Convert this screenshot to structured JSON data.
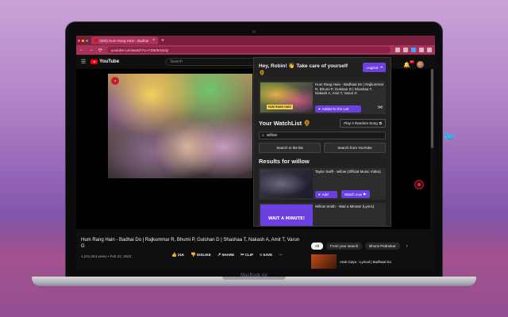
{
  "device": {
    "label": "MacBook Air"
  },
  "browser": {
    "tab_title": "(580) Hum Rang Hain - Badhai",
    "tab_close": "×",
    "new_tab": "+",
    "url": "youtube.com/watch?v=I7Z6Z5XaoQ"
  },
  "youtube": {
    "logo_text": "YouTube",
    "search_placeholder": "Search",
    "notification_count": "9+",
    "video_title": "Hum Rang Hain - Badhai Do | Rajkummar R, Bhumi P, Gulshan D | Shashaa T, Nakash A, Amit T, Varun G",
    "video_meta": "1,241,064 views • Feb 23, 2022",
    "actions": {
      "like": "21K",
      "dislike": "DISLIKE",
      "share": "SHARE",
      "clip": "CLIP",
      "save": "SAVE"
    },
    "chips": [
      "All",
      "From your search",
      "Bhumi Pednekar"
    ],
    "recommended_title": "Atak Gaya - Lyrical | Badhaai Do"
  },
  "extension": {
    "greeting": "Hey, Robin! 👋 Take care of yourself 🌻",
    "logout_label": "LogOut",
    "current_song": {
      "title": "Hum Rang Hain - Badhaai Do | Rajkummar R, Bhumi P, Gulshan D | Shashaa T, Nakash A, Amit T, Varun G",
      "thumb_label": "HUM RANG HAIN",
      "added_label": "Added to the List"
    },
    "watchlist_title": "Your WatchList 🌻",
    "random_label": "Play A Random Song",
    "search_value": "willow",
    "search_in_list": "Search in the list",
    "search_youtube": "Search from YouTube",
    "results_title": "Results for willow",
    "results": [
      {
        "title": "Taylor Swift - willow (Official Music Video)",
        "add_label": "Add",
        "watch_label": "Watch now"
      },
      {
        "title": "Willow Smith - Wait a Minute! (Lyrics)",
        "thumb_text": "WAIT A MINUTE!"
      }
    ]
  },
  "colors": {
    "accent": "#6c3fe0",
    "tab_bar": "#7a1f3d",
    "yt_red": "#ff0000"
  }
}
